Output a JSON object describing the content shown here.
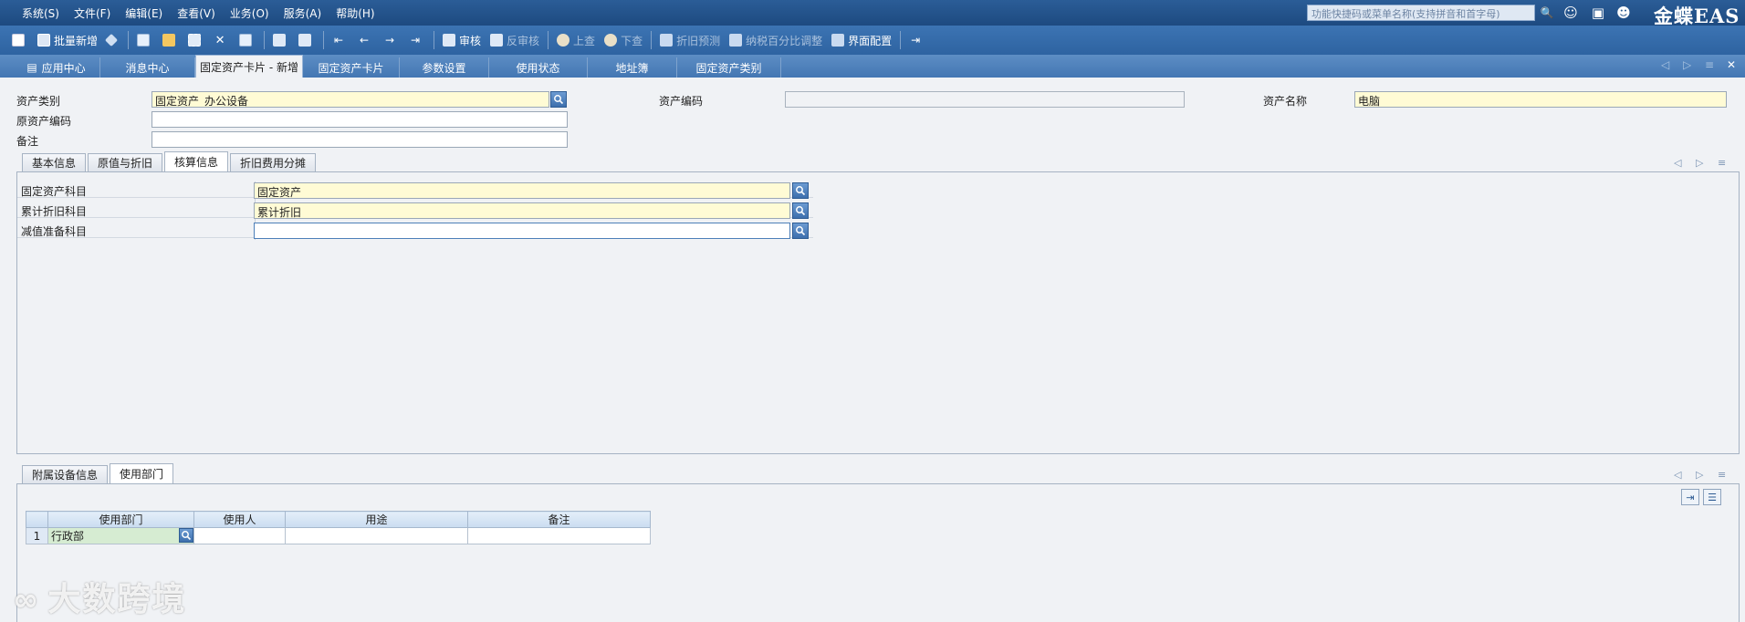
{
  "menubar": {
    "items": [
      "系统(S)",
      "文件(F)",
      "编辑(E)",
      "查看(V)",
      "业务(O)",
      "服务(A)",
      "帮助(H)"
    ],
    "search_placeholder": "功能快捷码或菜单名称(支持拼音和首字母)",
    "brand": "金蝶EAS"
  },
  "toolbar": {
    "batch_new": "批量新增",
    "audit": "审核",
    "unaudit": "反审核",
    "prev": "上查",
    "next": "下查",
    "depr_forecast": "折旧预测",
    "tax_ratio": "纳税百分比调整",
    "ui_config": "界面配置"
  },
  "tabs": [
    "应用中心",
    "消息中心",
    "固定资产卡片 - 新增",
    "固定资产卡片",
    "参数设置",
    "使用状态",
    "地址簿",
    "固定资产类别"
  ],
  "header_form": {
    "asset_category_label": "资产类别",
    "asset_category_value": "固定资产_办公设备",
    "asset_code_label": "资产编码",
    "asset_code_value": "",
    "asset_name_label": "资产名称",
    "asset_name_value": "电脑",
    "orig_code_label": "原资产编码",
    "orig_code_value": "",
    "remark_label": "备注",
    "remark_value": ""
  },
  "section_tabs": [
    "基本信息",
    "原值与折旧",
    "核算信息",
    "折旧费用分摊"
  ],
  "accounting": {
    "rows": [
      {
        "label": "固定资产科目",
        "value": "固定资产"
      },
      {
        "label": "累计折旧科目",
        "value": "累计折旧"
      },
      {
        "label": "减值准备科目",
        "value": ""
      }
    ]
  },
  "bottom_tabs": [
    "附属设备信息",
    "使用部门"
  ],
  "dept_table": {
    "headers": [
      "使用部门",
      "使用人",
      "用途",
      "备注"
    ],
    "rows": [
      {
        "no": "1",
        "dept": "行政部",
        "user": "",
        "purpose": "",
        "remark": ""
      }
    ]
  },
  "watermark": "大数跨境"
}
